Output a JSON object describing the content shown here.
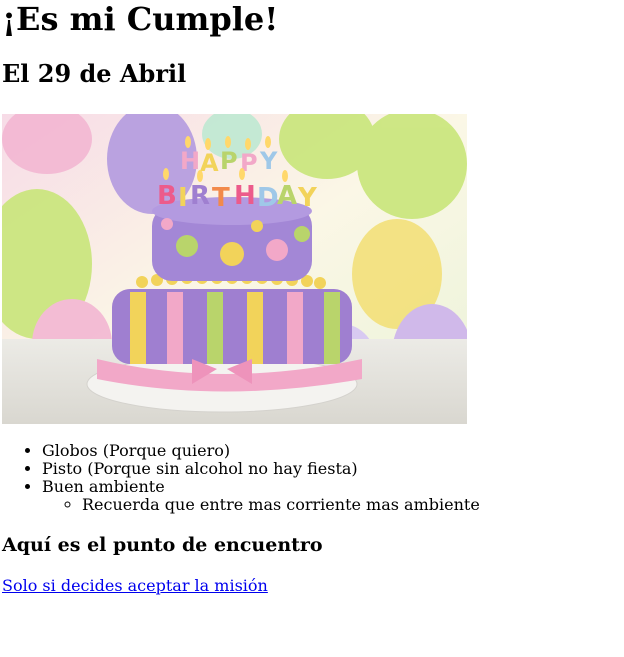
{
  "heading": "¡Es mi Cumple!",
  "date_heading": "El 29 de Abril",
  "image": {
    "cake_letters": [
      "H",
      "A",
      "P",
      "P",
      "Y",
      "B",
      "I",
      "R",
      "T",
      "H",
      "D",
      "A",
      "Y"
    ],
    "colors": {
      "balloon_purple": "#b49be0",
      "balloon_green": "#c9e67a",
      "balloon_yellow": "#f3e07a",
      "balloon_pink": "#f3b7d3",
      "cake_purple": "#9f7fd0",
      "cake_pink": "#f2a8c8",
      "cake_yellow": "#f2d35a",
      "cake_green": "#b9d46b"
    }
  },
  "list": [
    "Globos (Porque quiero)",
    "Pisto (Porque sin alcohol no hay fiesta)",
    "Buen ambiente"
  ],
  "sublist": [
    "Recuerda que entre mas corriente mas ambiente"
  ],
  "meeting_heading": "Aquí es el punto de encuentro",
  "link_text": "Solo si decides aceptar la misión"
}
